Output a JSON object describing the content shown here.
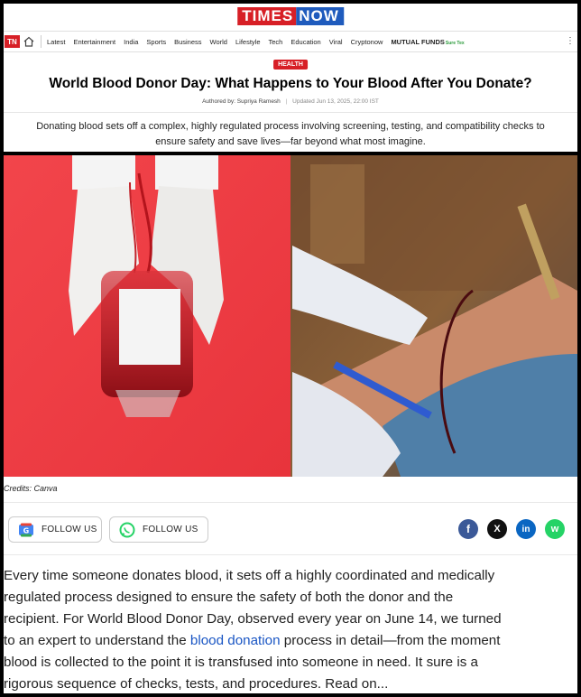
{
  "logo": {
    "part1": "TIMES",
    "part2": "NOW"
  },
  "navbar": {
    "badge": "TN",
    "items": [
      "Latest",
      "Entertainment",
      "India",
      "Sports",
      "Business",
      "World",
      "Lifestyle",
      "Tech",
      "Education",
      "Viral",
      "Cryptonow"
    ],
    "mutual_funds": "MUTUAL FUNDS",
    "mutual_funds_sub": "Sure Tex"
  },
  "article": {
    "tag": "HEALTH",
    "headline": "World Blood Donor Day: What Happens to Your Blood After You Donate?",
    "author_label": "Authored by:",
    "author": "Supriya Ramesh",
    "updated": "Updated Jun 13, 2025, 22:00 IST",
    "summary_line1": "Donating blood sets off a complex, highly regulated process involving screening, testing, and compatibility checks to",
    "summary_line2": "ensure safety and save lives—far beyond what most imagine.",
    "credits": "Credits: Canva"
  },
  "follow": {
    "google_label": "FOLLOW US",
    "whatsapp_label": "FOLLOW US"
  },
  "share": {
    "facebook": "f",
    "x": "X",
    "linkedin": "in",
    "whatsapp": "w"
  },
  "body": {
    "lines": [
      "Every time someone donates blood, it sets off a highly coordinated and medically",
      "regulated process designed to ensure the safety of both the donor and the",
      "recipient. For World Blood Donor Day, observed every year on June 14, we turned"
    ],
    "line4_before": "to an expert to understand the ",
    "link_text": "blood donation",
    "line4_after": " process in detail—from the moment",
    "lines_end": [
      "blood is collected to the point it is transfused into someone in need. It sure is a",
      "rigorous sequence of checks, tests, and procedures. Read on..."
    ]
  },
  "colors": {
    "brand_red": "#d71f26",
    "brand_blue": "#1f5bbd",
    "link": "#1a56c4"
  }
}
